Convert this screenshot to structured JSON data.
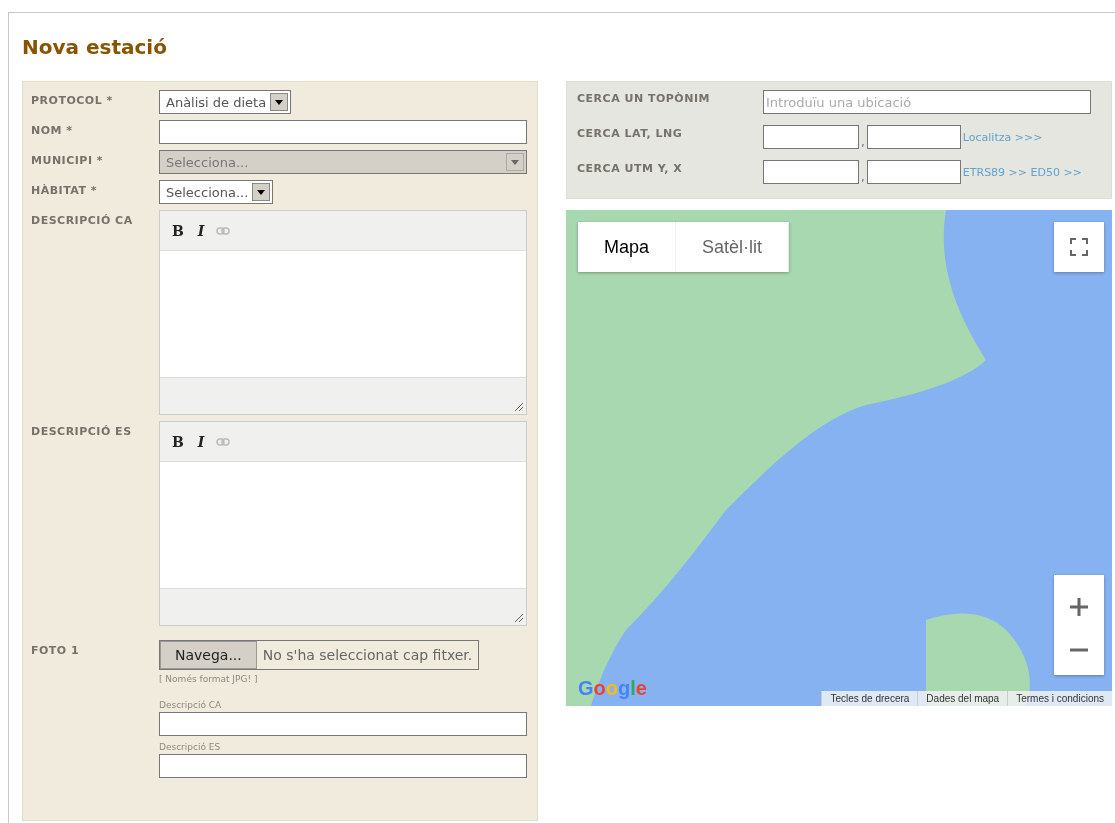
{
  "title": "Nova estació",
  "form": {
    "fields": [
      {
        "kind": "select",
        "label": "PROTOCOL *",
        "value": "Anàlisi de dieta",
        "disabled": false,
        "wide": false
      },
      {
        "kind": "text",
        "label": "NOM *"
      },
      {
        "kind": "select",
        "label": "MUNICIPI *",
        "value": "Selecciona...",
        "disabled": true,
        "wide": true
      },
      {
        "kind": "select",
        "label": "HÀBITAT *",
        "value": "Selecciona...",
        "disabled": false,
        "wide": false
      },
      {
        "kind": "editor",
        "label": "DESCRIPCIÓ CA",
        "bold": "B",
        "italic": "I"
      },
      {
        "kind": "editor",
        "label": "DESCRIPCIÓ ES",
        "bold": "B",
        "italic": "I"
      },
      {
        "kind": "file",
        "label": "FOTO 1",
        "button": "Navega...",
        "status": "No s'ha seleccionat cap fitxer.",
        "hint": "[ Només format JPG! ]",
        "captions": [
          {
            "label": "Descripció CA"
          },
          {
            "label": "Descripció ES"
          }
        ]
      }
    ]
  },
  "search": {
    "rows": [
      {
        "kind": "text",
        "label": "CERCA UN TOPÒNIM",
        "placeholder": "Introduïu una ubicació"
      },
      {
        "kind": "pair",
        "label": "CERCA LAT, LNG",
        "separator": ",",
        "link": "Localitza >>>"
      },
      {
        "kind": "pair",
        "label": "CERCA UTM Y, X",
        "separator": ",",
        "link": "ETRS89 >> ED50 >>"
      }
    ]
  },
  "map": {
    "types": [
      {
        "label": "Mapa",
        "selected": true
      },
      {
        "label": "Satèl·lit",
        "selected": false
      }
    ],
    "logo": "Google",
    "attribution": [
      "Tecles de drecera",
      "Dades del mapa",
      "Termes i condicions"
    ]
  }
}
